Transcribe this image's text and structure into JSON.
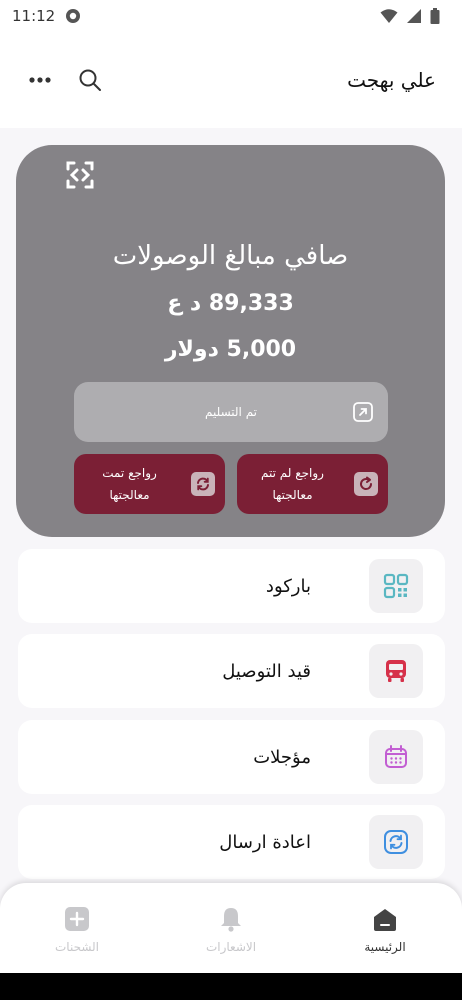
{
  "status_bar": {
    "time": "11:12"
  },
  "header": {
    "user_name": "علي بهجت"
  },
  "summary": {
    "title": "صافي مبالغ الوصولات",
    "amount_iqd": "89,333 د ع",
    "amount_usd": "5,000 دولار",
    "delivered_label": "تم التسليم",
    "returns_unprocessed_line1": "رواجع لم تتم",
    "returns_unprocessed_line2": "معالجتها",
    "returns_processed_line1": "رواجع تمت",
    "returns_processed_line2": "معالجتها"
  },
  "menu": [
    {
      "label": "باركود",
      "icon": "qr-code-icon",
      "color": "#5ab7c2"
    },
    {
      "label": "قيد التوصيل",
      "icon": "bus-icon",
      "color": "#d6314a"
    },
    {
      "label": "مؤجلات",
      "icon": "calendar-icon",
      "color": "#c25ed2"
    },
    {
      "label": "اعادة ارسال",
      "icon": "refresh-icon",
      "color": "#3f8fe0"
    }
  ],
  "bottom_nav": [
    {
      "label": "الرئيسية",
      "active": true
    },
    {
      "label": "الاشعارات",
      "active": false
    },
    {
      "label": "الشحنات",
      "active": false
    }
  ],
  "colors": {
    "card_bg": "#858387",
    "return_button_bg": "#7b1f35",
    "delivered_button_bg": "#aeadb0"
  }
}
